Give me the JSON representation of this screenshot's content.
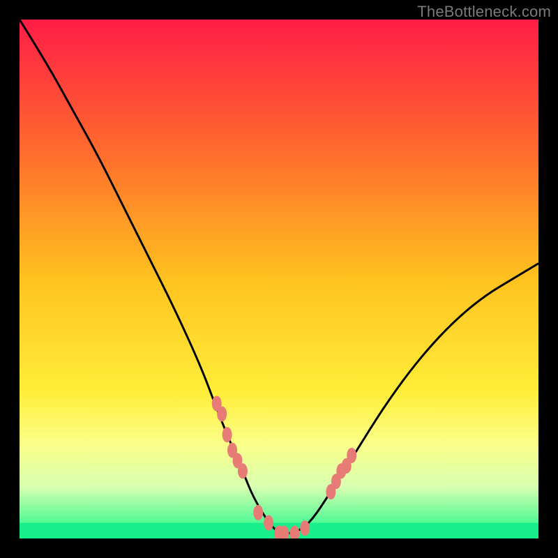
{
  "watermark": "TheBottleneck.com",
  "chart_data": {
    "type": "line",
    "title": "",
    "xlabel": "",
    "ylabel": "",
    "xlim": [
      0,
      100
    ],
    "ylim": [
      0,
      100
    ],
    "gradient_stops": [
      {
        "offset": 0,
        "color": "#ff1c47"
      },
      {
        "offset": 25,
        "color": "#ff6a2d"
      },
      {
        "offset": 50,
        "color": "#ffc21f"
      },
      {
        "offset": 72,
        "color": "#ffee3a"
      },
      {
        "offset": 82,
        "color": "#faff8a"
      },
      {
        "offset": 90,
        "color": "#d8ffb0"
      },
      {
        "offset": 100,
        "color": "#17f78a"
      }
    ],
    "series": [
      {
        "name": "bottleneck-curve",
        "x": [
          0,
          5,
          10,
          15,
          20,
          25,
          30,
          35,
          38,
          40,
          43,
          45,
          48,
          50,
          53,
          56,
          60,
          65,
          70,
          75,
          80,
          85,
          90,
          95,
          100
        ],
        "y": [
          100,
          92,
          83,
          74,
          64,
          54,
          44,
          33,
          25,
          20,
          13,
          8,
          3,
          1,
          1,
          3,
          9,
          17,
          25,
          32,
          38,
          43,
          47,
          50,
          53
        ]
      }
    ],
    "markers": {
      "name": "highlight-dots",
      "color": "#e77b76",
      "x": [
        38,
        39,
        40,
        41,
        42,
        43,
        46,
        48,
        50,
        51,
        53,
        55,
        60,
        61,
        62,
        63,
        64
      ],
      "y": [
        26,
        24,
        20,
        17,
        15,
        13,
        5,
        3,
        1,
        1,
        1,
        2,
        9,
        11,
        13,
        14,
        16
      ]
    },
    "bottom_band": {
      "name": "green-band",
      "color": "#17f08a",
      "from_y": 0,
      "to_y": 3
    }
  }
}
